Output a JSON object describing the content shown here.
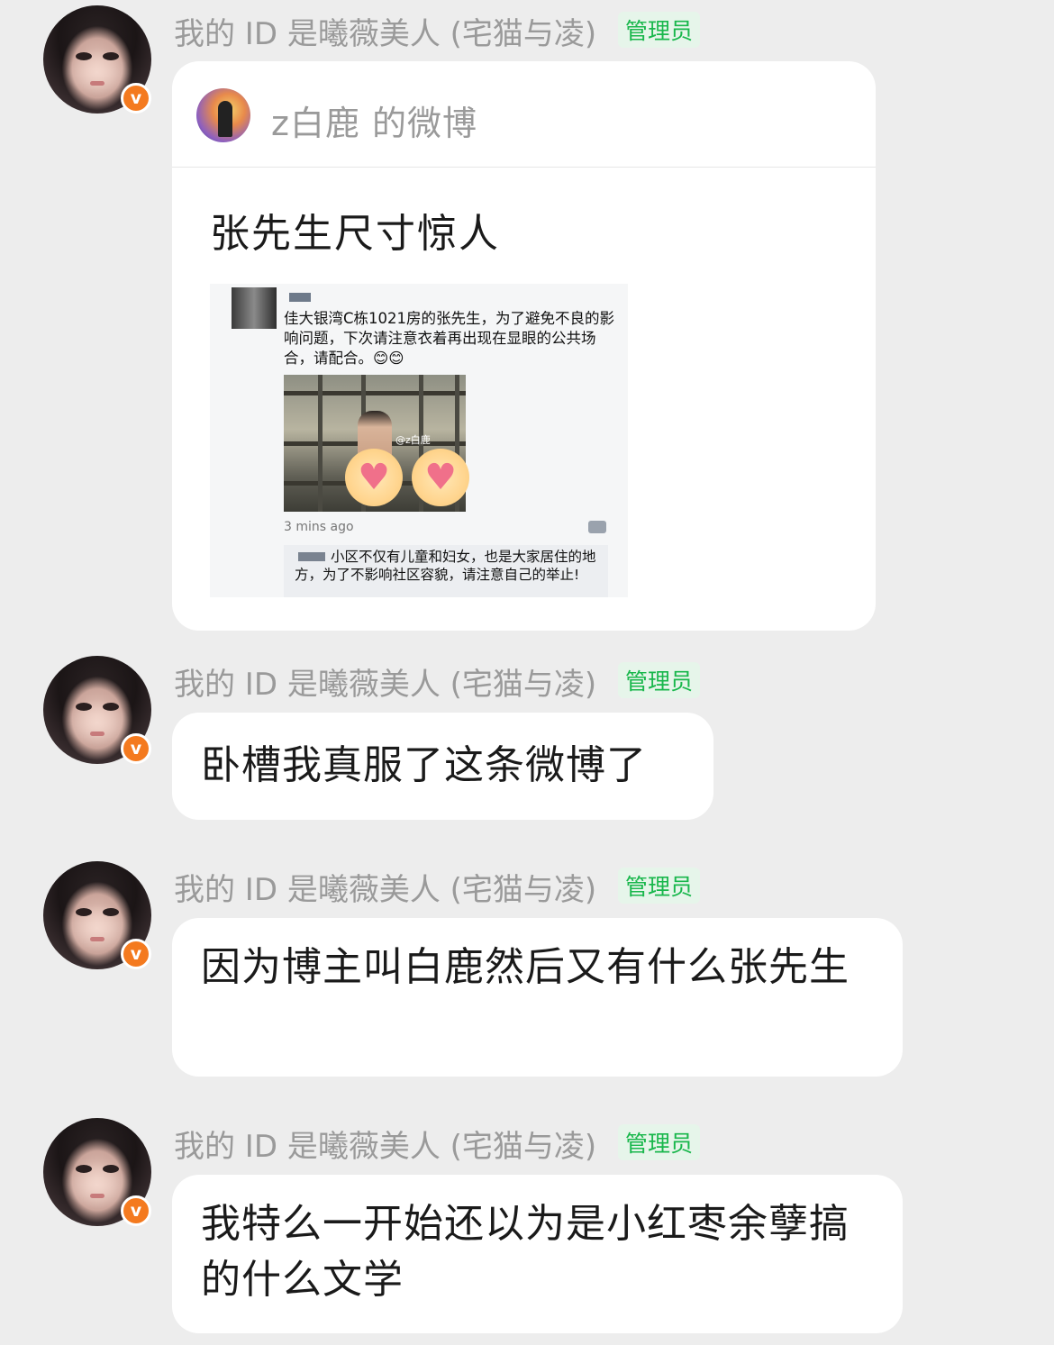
{
  "messages": [
    {
      "sender": "我的 ID 是曦薇美人 (宅猫与凌)",
      "role": "管理员",
      "badge": "v",
      "type": "weibo_card",
      "card": {
        "header": "z白鹿 的微博",
        "title": "张先生尺寸惊人",
        "screenshot": {
          "post_text": "佳大银湾C栋1021房的张先生，为了避免不良的影响问题，下次请注意衣着再出现在显眼的公共场合，请配合。😊😊",
          "watermark": "@z白鹿",
          "time": "3 mins ago",
          "reply_text": "小区不仅有儿童和妇女，也是大家居住的地方，为了不影响社区容貌，请注意自己的举止!"
        }
      }
    },
    {
      "sender": "我的 ID 是曦薇美人 (宅猫与凌)",
      "role": "管理员",
      "badge": "v",
      "type": "text",
      "text": "卧槽我真服了这条微博了"
    },
    {
      "sender": "我的 ID 是曦薇美人 (宅猫与凌)",
      "role": "管理员",
      "badge": "v",
      "type": "text",
      "text": "因为博主叫白鹿然后又有什么张先生"
    },
    {
      "sender": "我的 ID 是曦薇美人 (宅猫与凌)",
      "role": "管理员",
      "badge": "v",
      "type": "text",
      "text": "我特么一开始还以为是小红枣余孽搞的什么文学"
    }
  ],
  "colors": {
    "background": "#ededed",
    "bubble": "#ffffff",
    "role_text": "#19b74c",
    "role_bg": "#e6f5ea",
    "badge": "#f47a1f",
    "sender": "#9a9a9a"
  }
}
